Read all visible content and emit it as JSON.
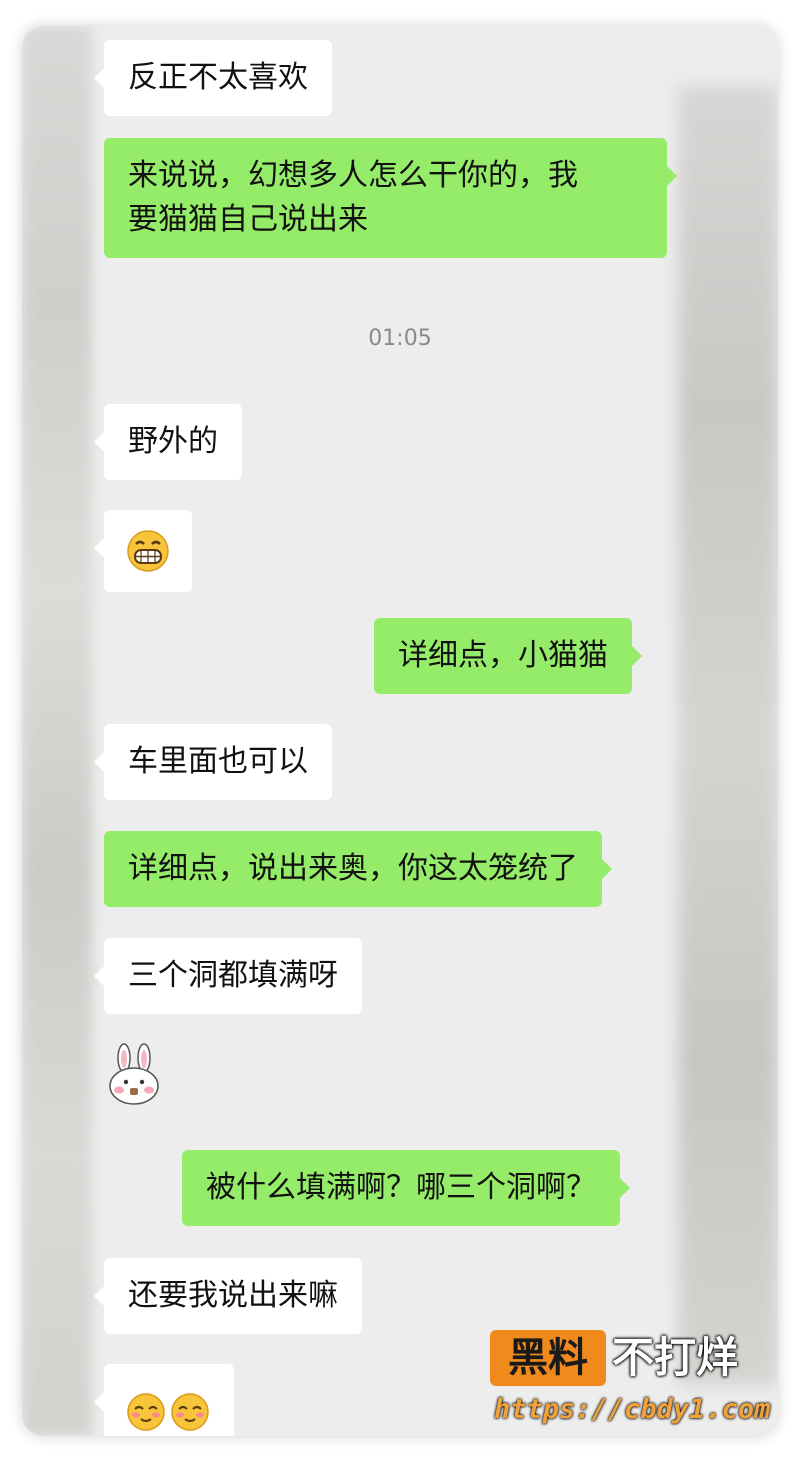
{
  "messages": {
    "m1": "反正不太喜欢",
    "m2_line1": "来说说，幻想多人怎么干你的，我",
    "m2_line2": "要猫猫自己说出来",
    "timestamp": "01:05",
    "m3": "野外的",
    "m5": "详细点，小猫猫",
    "m6": "车里面也可以",
    "m7": "详细点，说出来奥，你这太笼统了",
    "m8": "三个洞都填满呀",
    "m10": "被什么填满啊？哪三个洞啊？",
    "m11": "还要我说出来嘛"
  },
  "stickers": {
    "grin": "grin-emoji-icon",
    "bunny": "bunny-sticker-icon",
    "blush": "blush-emoji-icon"
  },
  "watermark": {
    "badge": "黑料",
    "text": "不打烊",
    "url": "https://cbdy1.com"
  },
  "colors": {
    "incoming_bubble": "#ffffff",
    "outgoing_bubble": "#95ec69",
    "chat_background": "#ededed",
    "timestamp_text": "#8a8a8a",
    "watermark_accent": "#f08a1c"
  }
}
